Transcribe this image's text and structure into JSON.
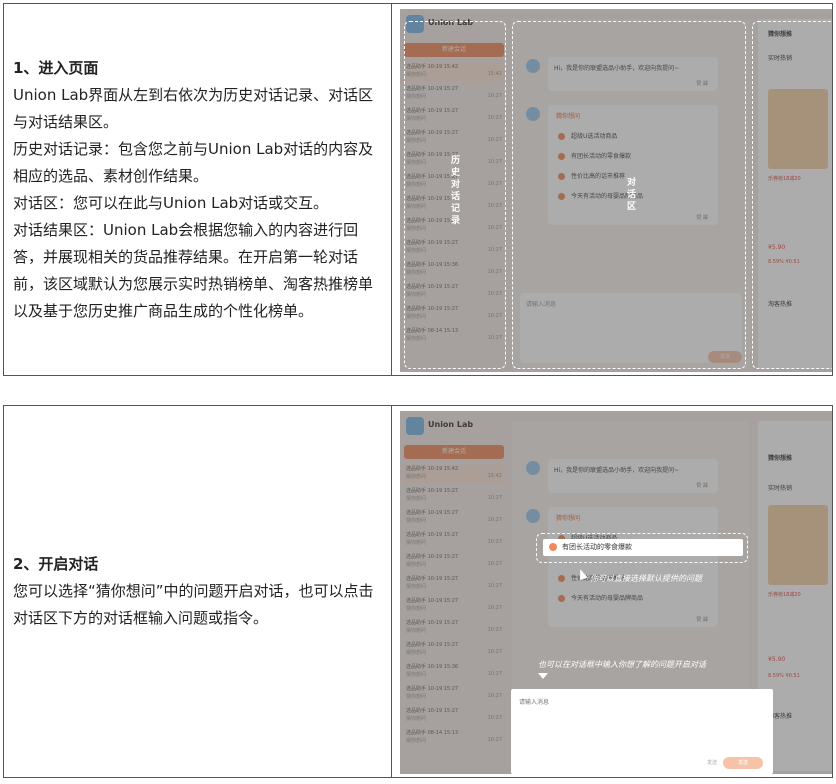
{
  "row1": {
    "heading": "1、进入页面",
    "paragraphs": [
      "Union Lab界面从左到右依次为历史对话记录、对话区与对话结果区。",
      "历史对话记录：包含您之前与Union Lab对话的内容及相应的选品、素材创作结果。",
      "对话区：您可以在此与Union Lab对话或交互。",
      "对话结果区：Union Lab会根据您输入的内容进行回答，并展现相关的货品推荐结果。在开启第一轮对话前，该区域默认为您展示实时热销榜单、淘客热推榜单以及基于您历史推广商品生成的个性化榜单。"
    ],
    "label_history": "历史对话记录",
    "label_chat": "对话区"
  },
  "row2": {
    "heading": "2、开启对话",
    "paragraph": "您可以选择“猜你想问”中的问题开启对话，也可以点击对话区下方的对话框输入问题或指令。",
    "highlight_item": "有团长活动的零食爆款",
    "annotation_select": "你可以直接选择默认提供的问题",
    "annotation_input": "也可以在对话框中输入你想了解的问题开启对话",
    "input_placeholder": "请输入消息",
    "send_shortcut": "发送",
    "send_button": "发送"
  },
  "app": {
    "brand": "Union Lab",
    "new_chat": "新建会话",
    "history": [
      {
        "name": "选品助手 10-19 15:42",
        "sub": "猜你想问",
        "time": "15:42"
      },
      {
        "name": "选品助手 10-19 15:27",
        "sub": "猜你想问",
        "time": "10:27"
      },
      {
        "name": "选品助手 10-19 15:27",
        "sub": "猜你想问",
        "time": "10:27"
      },
      {
        "name": "选品助手 10-19 15:27",
        "sub": "猜你想问",
        "time": "10:27"
      },
      {
        "name": "选品助手 10-19 15:27",
        "sub": "猜你想问",
        "time": "10:27"
      },
      {
        "name": "选品助手 10-19 15:27",
        "sub": "猜你想问",
        "time": "10:27"
      },
      {
        "name": "选品助手 10-19 15:27",
        "sub": "猜你想问",
        "time": "10:27"
      },
      {
        "name": "选品助手 10-19 15:27",
        "sub": "猜你想问",
        "time": "10:27"
      },
      {
        "name": "选品助手 10-19 15:27",
        "sub": "猜你想问",
        "time": "10:27"
      },
      {
        "name": "选品助手 10-19 15:36",
        "sub": "猜你想问",
        "time": "10:27"
      },
      {
        "name": "选品助手 10-19 15:27",
        "sub": "猜你想问",
        "time": "10:27"
      },
      {
        "name": "选品助手 10-19 15:27",
        "sub": "猜你想问",
        "time": "10:27"
      },
      {
        "name": "选品助手 08-14 15:13",
        "sub": "猜你想问",
        "time": "10:27"
      }
    ],
    "greeting": "Hi，我是你的联盟选品小助手，欢迎向我提问~",
    "like": "赞",
    "dislike": "踩",
    "guess_title": "猜你想问",
    "suggestions": [
      "超级U选活动商品",
      "有团长活动的零食爆款",
      "性价比高的话市推荐",
      "今天有活动的母婴品牌商品"
    ],
    "right_title": "猜你想推",
    "right_sub1": "实时热销",
    "right_sub2": "淘客热推",
    "promo": "乐券抢18减20",
    "price": "¥5.90",
    "rate1": "8.59%",
    "rate2": "¥0.51"
  }
}
